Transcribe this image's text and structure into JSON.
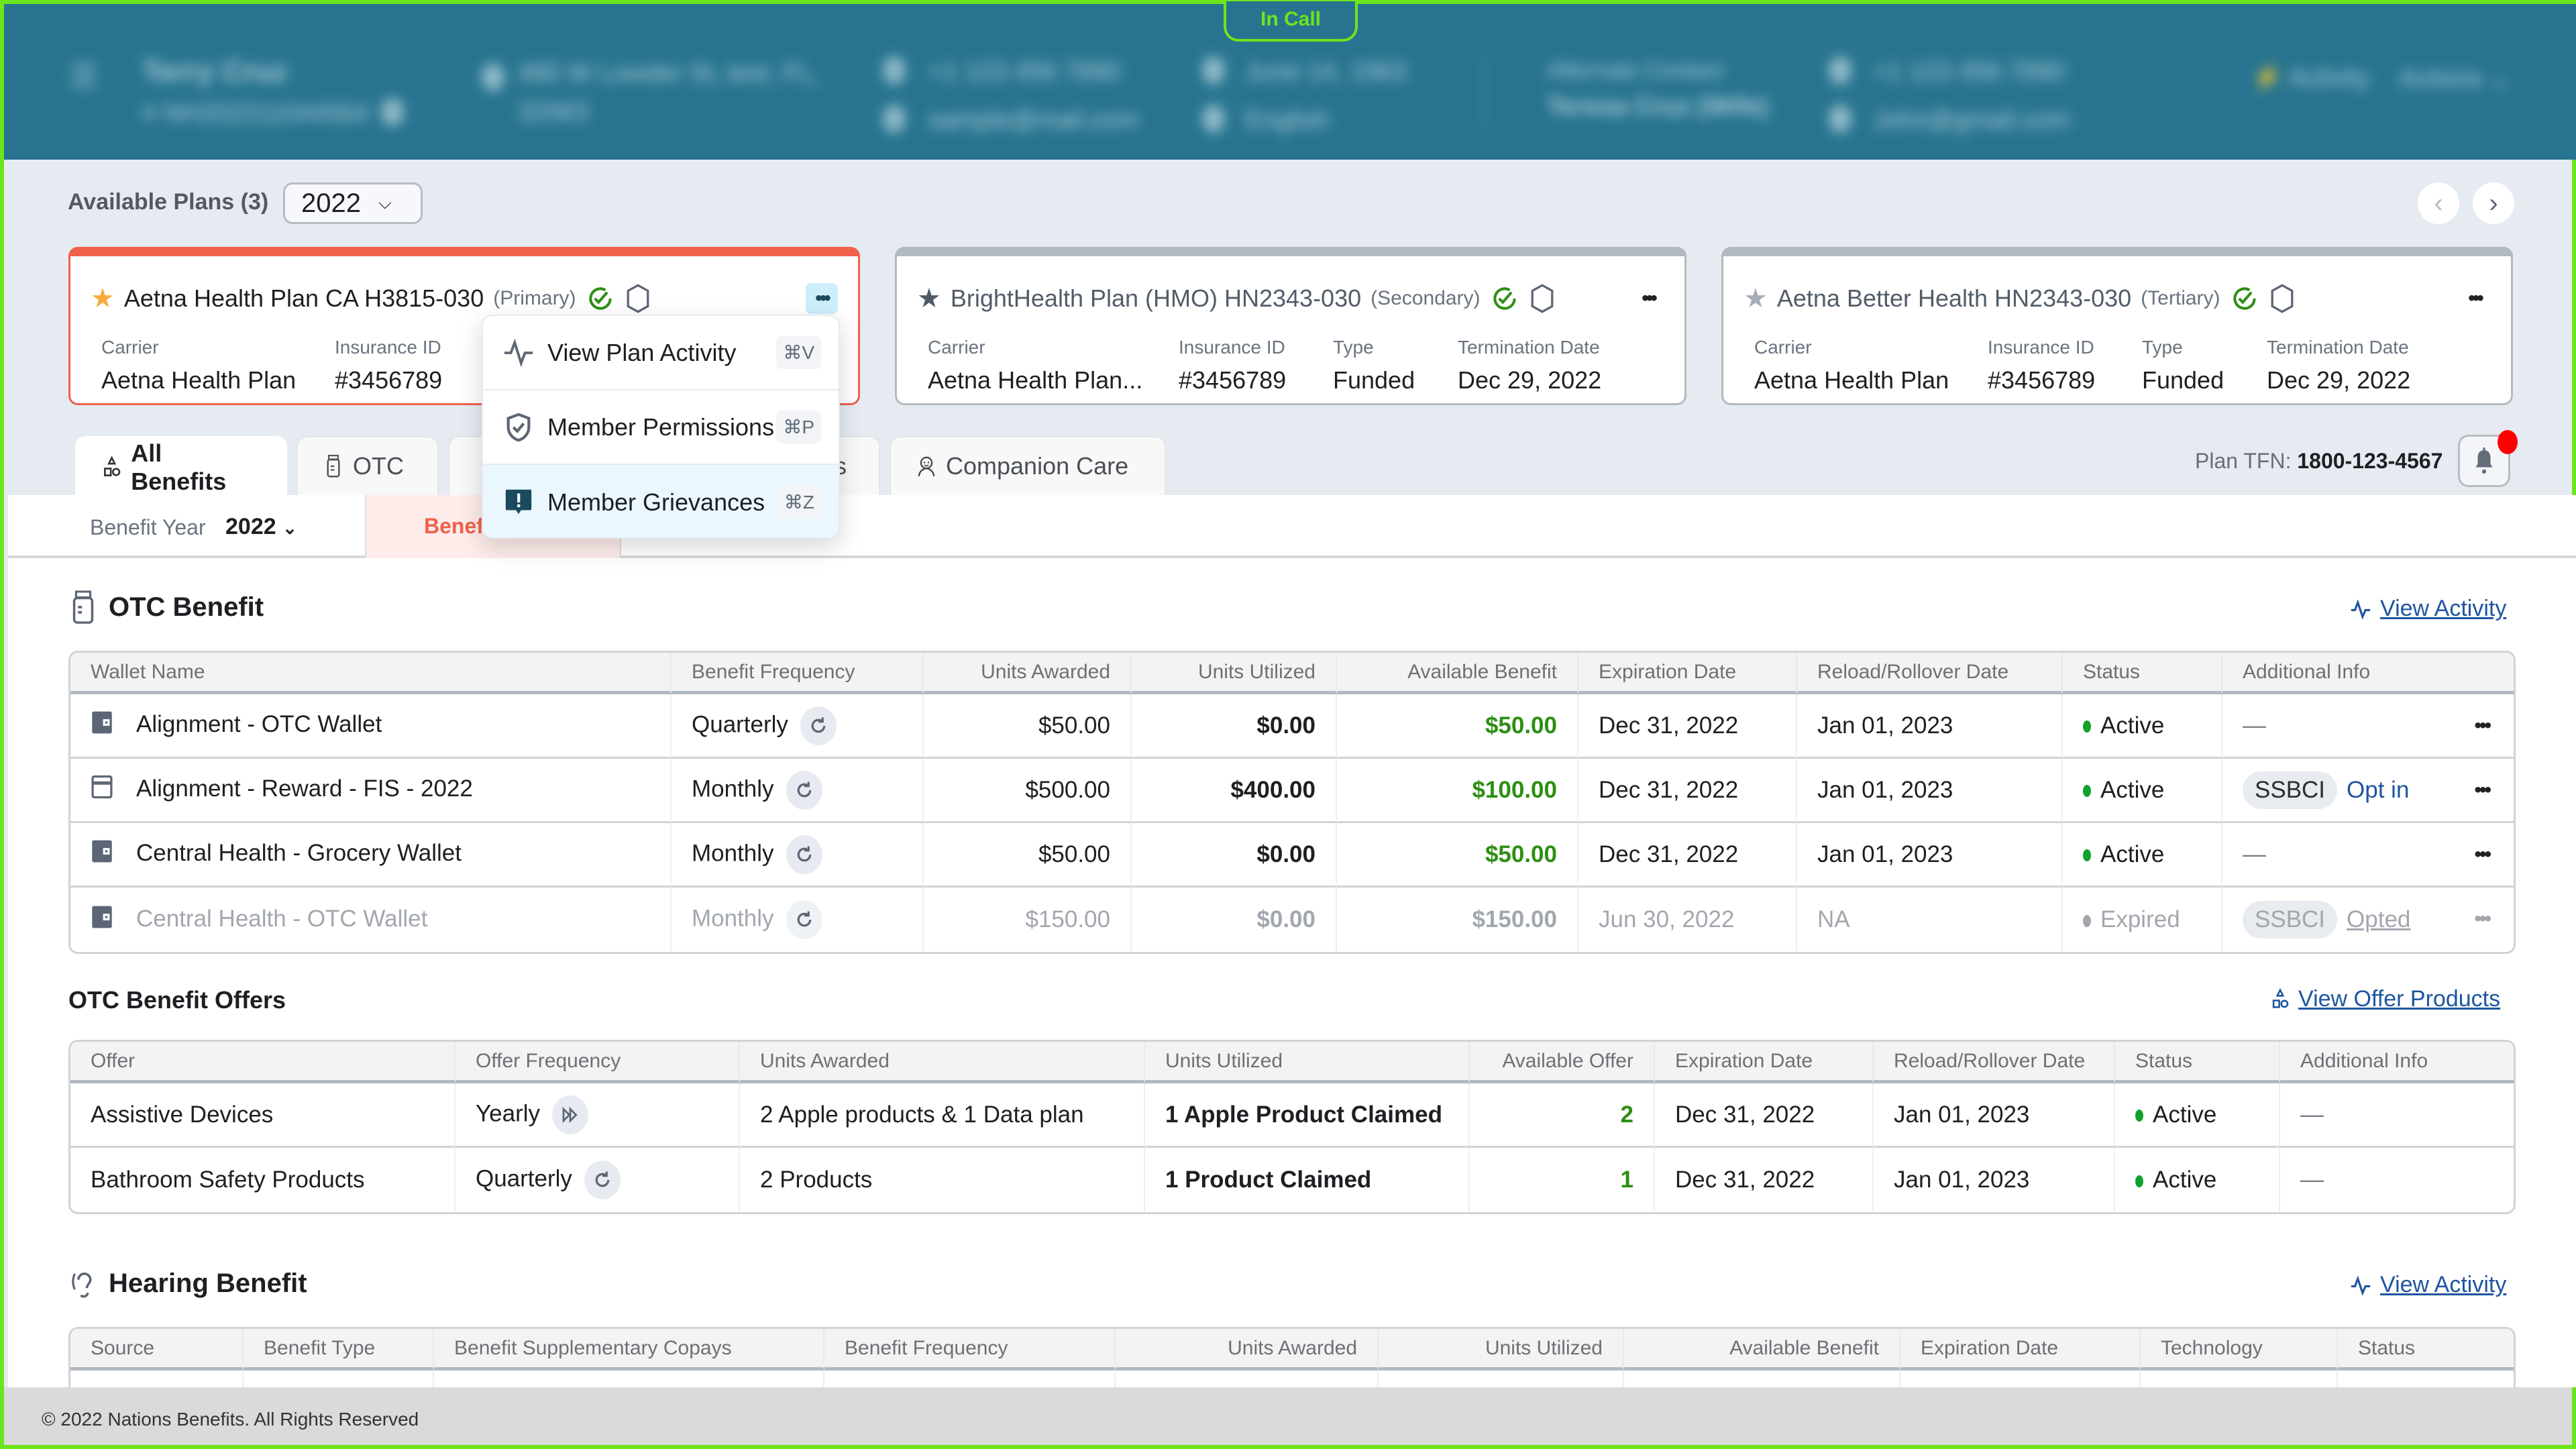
{
  "header": {
    "in_call_label": "In Call",
    "member_name": "Terry Cruz",
    "member_id": "# NH202211044564",
    "address_line1": "480 W Lowder St, test, FL,",
    "address_line2": "32063",
    "phone": "+1 123 456 7890",
    "email": "sample@mail.com",
    "dob": "June 14, 1963",
    "language": "English",
    "alternate_contact_label": "Alternate Contact",
    "alternate_contact_name": "Teresa Cruz (Wife)",
    "alternate_phone": "+1 123 456 7890",
    "alternate_email": "John@gmail.com",
    "activity_label": "Activity",
    "actions_label": "Actions"
  },
  "plans_bar": {
    "label": "Available Plans (3)",
    "year": "2022"
  },
  "plans": [
    {
      "name": "Aetna Health Plan CA H3815-030",
      "role": "(Primary)",
      "fields": [
        {
          "label": "Carrier",
          "value": "Aetna Health Plan"
        },
        {
          "label": "Insurance ID",
          "value": "#3456789"
        }
      ]
    },
    {
      "name": "BrightHealth Plan (HMO) HN2343-030",
      "role": "(Secondary)",
      "fields": [
        {
          "label": "Carrier",
          "value": "Aetna Health Plan..."
        },
        {
          "label": "Insurance ID",
          "value": "#3456789"
        },
        {
          "label": "Type",
          "value": "Funded"
        },
        {
          "label": "Termination Date",
          "value": "Dec 29, 2022"
        }
      ]
    },
    {
      "name": "Aetna Better Health HN2343-030",
      "role": "(Tertiary)",
      "fields": [
        {
          "label": "Carrier",
          "value": "Aetna Health Plan"
        },
        {
          "label": "Insurance ID",
          "value": "#3456789"
        },
        {
          "label": "Type",
          "value": "Funded"
        },
        {
          "label": "Termination Date",
          "value": "Dec 29, 2022"
        }
      ]
    }
  ],
  "plan_menu": {
    "items": [
      {
        "label": "View Plan Activity",
        "shortcut": "⌘V",
        "icon": "activity-icon"
      },
      {
        "label": "Member Permissions",
        "shortcut": "⌘P",
        "icon": "shield-check-icon"
      },
      {
        "label": "Member Grievances",
        "shortcut": "⌘Z",
        "icon": "alert-message-icon"
      }
    ],
    "highlighted": "Member Grievances"
  },
  "tabs": [
    {
      "label": "All Benefits",
      "active": true
    },
    {
      "label": "OTC"
    },
    {
      "label": "Meals"
    },
    {
      "label": "Companion Care"
    }
  ],
  "plan_tfn": {
    "label": "Plan TFN:",
    "value": "1800-123-4567"
  },
  "sub_bar": {
    "benefit_year_label": "Benefit Year",
    "benefit_year_value": "2022",
    "active_sub_tab": "Benefi"
  },
  "otc_benefit": {
    "title": "OTC Benefit",
    "view_activity": "View Activity",
    "columns": [
      "Wallet Name",
      "Benefit Frequency",
      "Units Awarded",
      "Units Utilized",
      "Available Benefit",
      "Expiration Date",
      "Reload/Rollover Date",
      "Status",
      "Additional Info"
    ],
    "rows": [
      {
        "wallet": "Alignment - OTC Wallet",
        "frequency": "Quarterly",
        "awarded": "$50.00",
        "utilized": "$0.00",
        "available": "$50.00",
        "expiration": "Dec 31, 2022",
        "reload": "Jan 01, 2023",
        "status": "Active",
        "info_tag": "",
        "info_link": "",
        "info_dash": "—"
      },
      {
        "wallet": "Alignment - Reward - FIS - 2022",
        "frequency": "Monthly",
        "awarded": "$500.00",
        "utilized": "$400.00",
        "available": "$100.00",
        "expiration": "Dec 31, 2022",
        "reload": "Jan 01, 2023",
        "status": "Active",
        "info_tag": "SSBCI",
        "info_link": "Opt in",
        "info_dash": ""
      },
      {
        "wallet": "Central Health - Grocery Wallet",
        "frequency": "Monthly",
        "awarded": "$50.00",
        "utilized": "$0.00",
        "available": "$50.00",
        "expiration": "Dec 31, 2022",
        "reload": "Jan 01, 2023",
        "status": "Active",
        "info_tag": "",
        "info_link": "",
        "info_dash": "—"
      },
      {
        "wallet": "Central Health - OTC Wallet",
        "frequency": "Monthly",
        "awarded": "$150.00",
        "utilized": "$0.00",
        "available": "$150.00",
        "expiration": "Jun 30, 2022",
        "reload": "NA",
        "status": "Expired",
        "info_tag": "SSBCI",
        "info_link": "Opted",
        "info_dash": ""
      }
    ]
  },
  "otc_offers": {
    "title": "OTC Benefit Offers",
    "view_products": "View Offer Products",
    "columns": [
      "Offer",
      "Offer Frequency",
      "Units Awarded",
      "Units Utilized",
      "Available Offer",
      "Expiration Date",
      "Reload/Rollover Date",
      "Status",
      "Additional Info"
    ],
    "rows": [
      {
        "offer": "Assistive Devices",
        "frequency": "Yearly",
        "awarded": "2 Apple products & 1 Data plan",
        "utilized": "1 Apple Product Claimed",
        "available": "2",
        "expiration": "Dec 31, 2022",
        "reload": "Jan 01, 2023",
        "status": "Active",
        "info": "—"
      },
      {
        "offer": "Bathroom Safety Products",
        "frequency": "Quarterly",
        "awarded": "2 Products",
        "utilized": "1 Product Claimed",
        "available": "1",
        "expiration": "Dec 31, 2022",
        "reload": "Jan 01, 2023",
        "status": "Active",
        "info": "—"
      }
    ]
  },
  "hearing_benefit": {
    "title": "Hearing Benefit",
    "view_activity": "View Activity",
    "columns": [
      "Source",
      "Benefit Type",
      "Benefit Supplementary Copays",
      "Benefit Frequency",
      "Units Awarded",
      "Units Utilized",
      "Available Benefit",
      "Expiration Date",
      "Technology",
      "Status"
    ]
  },
  "footer": {
    "copyright": "© 2022 Nations Benefits. All Rights Reserved"
  },
  "colors": {
    "header_bg": "#287490",
    "accent_red": "#f0604a",
    "link_blue": "#1e55a0",
    "positive_green": "#2d8f14",
    "active_dot": "#12a12c",
    "in_call_green": "#6ce51c"
  }
}
